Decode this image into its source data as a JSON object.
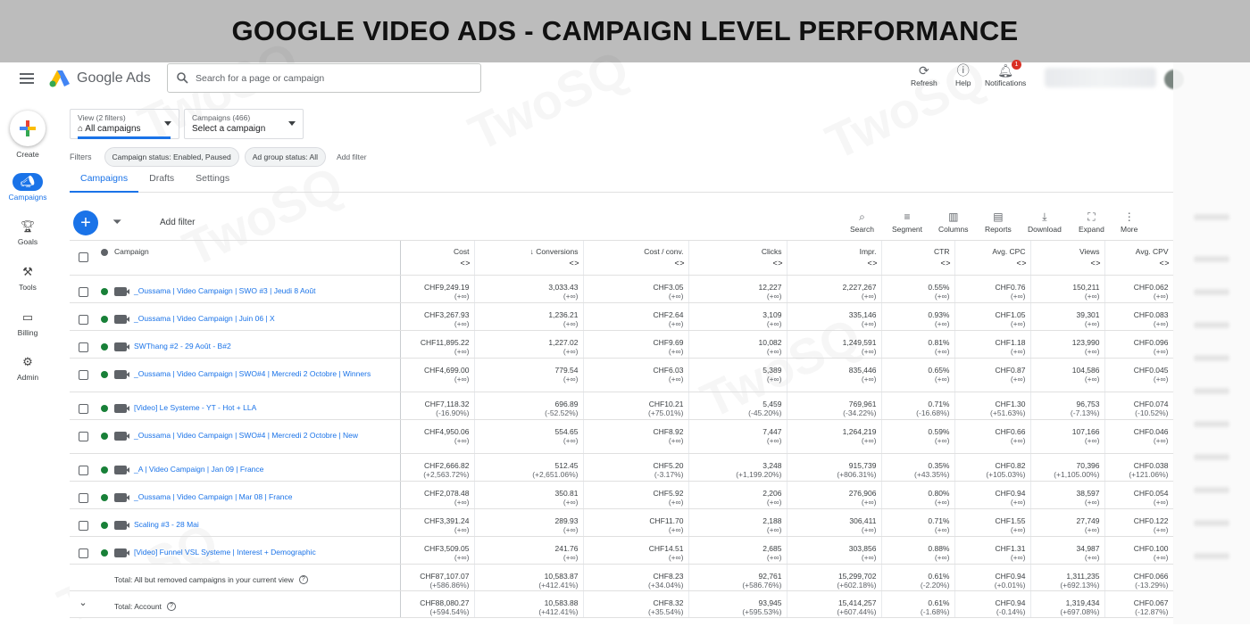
{
  "banner": {
    "title": "GOOGLE VIDEO ADS - CAMPAIGN LEVEL PERFORMANCE"
  },
  "topbar": {
    "logo_text": "Google Ads",
    "search_placeholder": "Search for a page or campaign",
    "actions": [
      {
        "label": "Refresh",
        "icon": "refresh-icon"
      },
      {
        "label": "Help",
        "icon": "help-icon"
      },
      {
        "label": "Notifications",
        "icon": "bell-icon",
        "badge": "1"
      }
    ]
  },
  "leftnav": [
    {
      "label": "Create",
      "icon": "plus-icon"
    },
    {
      "label": "Campaigns",
      "icon": "megaphone-icon",
      "active": true
    },
    {
      "label": "Goals",
      "icon": "trophy-icon"
    },
    {
      "label": "Tools",
      "icon": "wrench-icon"
    },
    {
      "label": "Billing",
      "icon": "card-icon"
    },
    {
      "label": "Admin",
      "icon": "gear-icon"
    }
  ],
  "view": {
    "label": "View (2 filters)",
    "value": "All campaigns"
  },
  "campaign_select": {
    "label": "Campaigns (466)",
    "value": "Select a campaign"
  },
  "filters": {
    "label": "Filters",
    "chips": [
      "Campaign status: Enabled, Paused",
      "Ad group status: All"
    ],
    "add": "Add filter"
  },
  "subtabs": [
    "Campaigns",
    "Drafts",
    "Settings"
  ],
  "toolbar": {
    "add_filter": "Add filter",
    "tools": [
      {
        "label": "Search",
        "icon": "search-icon"
      },
      {
        "label": "Segment",
        "icon": "segment-icon"
      },
      {
        "label": "Columns",
        "icon": "columns-icon"
      },
      {
        "label": "Reports",
        "icon": "reports-icon"
      },
      {
        "label": "Download",
        "icon": "download-icon"
      },
      {
        "label": "Expand",
        "icon": "expand-icon"
      },
      {
        "label": "More",
        "icon": "more-icon"
      }
    ]
  },
  "table": {
    "headers": [
      "Campaign",
      "Cost",
      "↓ Conversions",
      "Cost / conv.",
      "Clicks",
      "Impr.",
      "CTR",
      "Avg. CPC",
      "Views",
      "Avg. CPV"
    ],
    "rows": [
      {
        "name": "_Oussama | Video Campaign | SWO #3 | Jeudi 8 Août",
        "cells": [
          [
            "CHF9,249.19",
            "(+∞)"
          ],
          [
            "3,033.43",
            "(+∞)"
          ],
          [
            "CHF3.05",
            "(+∞)"
          ],
          [
            "12,227",
            "(+∞)"
          ],
          [
            "2,227,267",
            "(+∞)"
          ],
          [
            "0.55%",
            "(+∞)"
          ],
          [
            "CHF0.76",
            "(+∞)"
          ],
          [
            "150,211",
            "(+∞)"
          ],
          [
            "CHF0.062",
            "(+∞)"
          ]
        ]
      },
      {
        "name": "_Oussama | Video Campaign | Juin 06 | X",
        "cells": [
          [
            "CHF3,267.93",
            "(+∞)"
          ],
          [
            "1,236.21",
            "(+∞)"
          ],
          [
            "CHF2.64",
            "(+∞)"
          ],
          [
            "3,109",
            "(+∞)"
          ],
          [
            "335,146",
            "(+∞)"
          ],
          [
            "0.93%",
            "(+∞)"
          ],
          [
            "CHF1.05",
            "(+∞)"
          ],
          [
            "39,301",
            "(+∞)"
          ],
          [
            "CHF0.083",
            "(+∞)"
          ]
        ]
      },
      {
        "name": "SWThang #2 - 29 Août - B#2",
        "cells": [
          [
            "CHF11,895.22",
            "(+∞)"
          ],
          [
            "1,227.02",
            "(+∞)"
          ],
          [
            "CHF9.69",
            "(+∞)"
          ],
          [
            "10,082",
            "(+∞)"
          ],
          [
            "1,249,591",
            "(+∞)"
          ],
          [
            "0.81%",
            "(+∞)"
          ],
          [
            "CHF1.18",
            "(+∞)"
          ],
          [
            "123,990",
            "(+∞)"
          ],
          [
            "CHF0.096",
            "(+∞)"
          ]
        ]
      },
      {
        "name": "_Oussama | Video Campaign | SWO#4 | Mercredi 2 Octobre | Winners",
        "cells": [
          [
            "CHF4,699.00",
            "(+∞)"
          ],
          [
            "779.54",
            "(+∞)"
          ],
          [
            "CHF6.03",
            "(+∞)"
          ],
          [
            "5,389",
            "(+∞)"
          ],
          [
            "835,446",
            "(+∞)"
          ],
          [
            "0.65%",
            "(+∞)"
          ],
          [
            "CHF0.87",
            "(+∞)"
          ],
          [
            "104,586",
            "(+∞)"
          ],
          [
            "CHF0.045",
            "(+∞)"
          ]
        ]
      },
      {
        "name": "[Video] Le Systeme - YT - Hot + LLA",
        "cells": [
          [
            "CHF7,118.32",
            "(-16.90%)"
          ],
          [
            "696.89",
            "(-52.52%)"
          ],
          [
            "CHF10.21",
            "(+75.01%)"
          ],
          [
            "5,459",
            "(-45.20%)"
          ],
          [
            "769,961",
            "(-34.22%)"
          ],
          [
            "0.71%",
            "(-16.68%)"
          ],
          [
            "CHF1.30",
            "(+51.63%)"
          ],
          [
            "96,753",
            "(-7.13%)"
          ],
          [
            "CHF0.074",
            "(-10.52%)"
          ]
        ]
      },
      {
        "name": "_Oussama | Video Campaign | SWO#4 | Mercredi 2 Octobre | New",
        "cells": [
          [
            "CHF4,950.06",
            "(+∞)"
          ],
          [
            "554.65",
            "(+∞)"
          ],
          [
            "CHF8.92",
            "(+∞)"
          ],
          [
            "7,447",
            "(+∞)"
          ],
          [
            "1,264,219",
            "(+∞)"
          ],
          [
            "0.59%",
            "(+∞)"
          ],
          [
            "CHF0.66",
            "(+∞)"
          ],
          [
            "107,166",
            "(+∞)"
          ],
          [
            "CHF0.046",
            "(+∞)"
          ]
        ]
      },
      {
        "name": "_A | Video Campaign | Jan 09 | France",
        "cells": [
          [
            "CHF2,666.82",
            "(+2,563.72%)"
          ],
          [
            "512.45",
            "(+2,651.06%)"
          ],
          [
            "CHF5.20",
            "(-3.17%)"
          ],
          [
            "3,248",
            "(+1,199.20%)"
          ],
          [
            "915,739",
            "(+806.31%)"
          ],
          [
            "0.35%",
            "(+43.35%)"
          ],
          [
            "CHF0.82",
            "(+105.03%)"
          ],
          [
            "70,396",
            "(+1,105.00%)"
          ],
          [
            "CHF0.038",
            "(+121.06%)"
          ]
        ]
      },
      {
        "name": "_Oussama | Video Campaign | Mar 08 | France",
        "cells": [
          [
            "CHF2,078.48",
            "(+∞)"
          ],
          [
            "350.81",
            "(+∞)"
          ],
          [
            "CHF5.92",
            "(+∞)"
          ],
          [
            "2,206",
            "(+∞)"
          ],
          [
            "276,906",
            "(+∞)"
          ],
          [
            "0.80%",
            "(+∞)"
          ],
          [
            "CHF0.94",
            "(+∞)"
          ],
          [
            "38,597",
            "(+∞)"
          ],
          [
            "CHF0.054",
            "(+∞)"
          ]
        ]
      },
      {
        "name": "Scaling #3 - 28 Mai",
        "cells": [
          [
            "CHF3,391.24",
            "(+∞)"
          ],
          [
            "289.93",
            "(+∞)"
          ],
          [
            "CHF11.70",
            "(+∞)"
          ],
          [
            "2,188",
            "(+∞)"
          ],
          [
            "306,411",
            "(+∞)"
          ],
          [
            "0.71%",
            "(+∞)"
          ],
          [
            "CHF1.55",
            "(+∞)"
          ],
          [
            "27,749",
            "(+∞)"
          ],
          [
            "CHF0.122",
            "(+∞)"
          ]
        ]
      },
      {
        "name": "[Video] Funnel VSL Systeme | Interest + Demographic",
        "cells": [
          [
            "CHF3,509.05",
            "(+∞)"
          ],
          [
            "241.76",
            "(+∞)"
          ],
          [
            "CHF14.51",
            "(+∞)"
          ],
          [
            "2,685",
            "(+∞)"
          ],
          [
            "303,856",
            "(+∞)"
          ],
          [
            "0.88%",
            "(+∞)"
          ],
          [
            "CHF1.31",
            "(+∞)"
          ],
          [
            "34,987",
            "(+∞)"
          ],
          [
            "CHF0.100",
            "(+∞)"
          ]
        ]
      }
    ],
    "totals": [
      {
        "label": "Total: All but removed campaigns in your current view",
        "cells": [
          [
            "CHF87,107.07",
            "(+586.86%)"
          ],
          [
            "10,583.87",
            "(+412.41%)"
          ],
          [
            "CHF8.23",
            "(+34.04%)"
          ],
          [
            "92,761",
            "(+586.76%)"
          ],
          [
            "15,299,702",
            "(+602.18%)"
          ],
          [
            "0.61%",
            "(-2.20%)"
          ],
          [
            "CHF0.94",
            "(+0.01%)"
          ],
          [
            "1,311,235",
            "(+692.13%)"
          ],
          [
            "CHF0.066",
            "(-13.29%)"
          ]
        ]
      },
      {
        "label": "Total: Account",
        "cells": [
          [
            "CHF88,080.27",
            "(+594.54%)"
          ],
          [
            "10,583.88",
            "(+412.41%)"
          ],
          [
            "CHF8.32",
            "(+35.54%)"
          ],
          [
            "93,945",
            "(+595.53%)"
          ],
          [
            "15,414,257",
            "(+607.44%)"
          ],
          [
            "0.61%",
            "(-1.68%)"
          ],
          [
            "CHF0.94",
            "(-0.14%)"
          ],
          [
            "1,319,434",
            "(+697.08%)"
          ],
          [
            "CHF0.067",
            "(-12.87%)"
          ]
        ]
      }
    ]
  },
  "colors": {
    "accent": "#1a73e8",
    "status_enabled": "#188038",
    "banner_bg": "#bcbcbc"
  }
}
